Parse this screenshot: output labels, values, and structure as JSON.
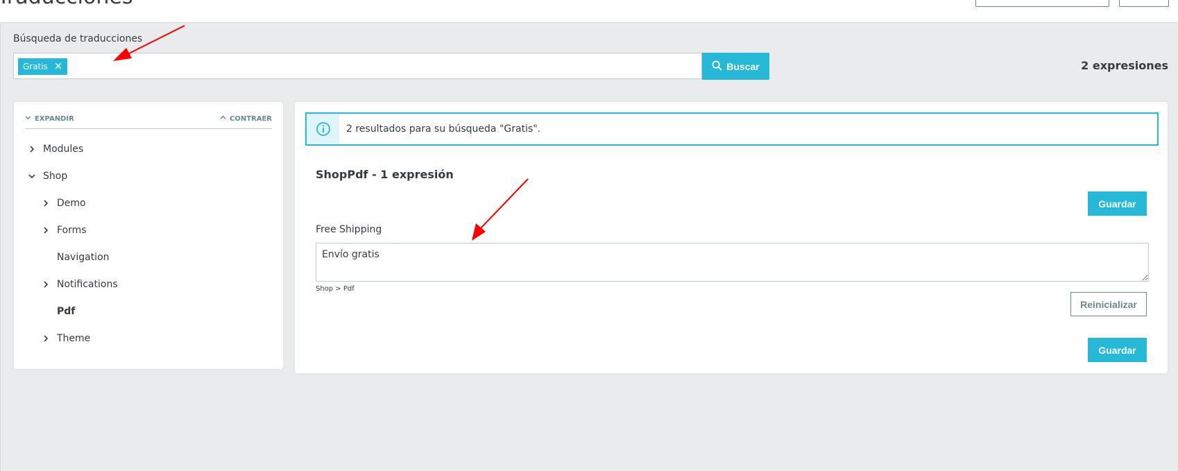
{
  "header": {
    "title": "Traducciones"
  },
  "search": {
    "label": "Búsqueda de traducciones",
    "tags": [
      {
        "label": "Gratis"
      }
    ],
    "button_label": "Buscar",
    "expressions_count": "2 expresiones"
  },
  "tree": {
    "expand_label": "EXPANDIR",
    "collapse_label": "CONTRAER",
    "items": [
      {
        "label": "Modules",
        "level": 0,
        "chevron": "right"
      },
      {
        "label": "Shop",
        "level": 0,
        "chevron": "down"
      },
      {
        "label": "Demo",
        "level": 1,
        "chevron": "right"
      },
      {
        "label": "Forms",
        "level": 1,
        "chevron": "right"
      },
      {
        "label": "Navigation",
        "level": 1,
        "chevron": "none"
      },
      {
        "label": "Notifications",
        "level": 1,
        "chevron": "right"
      },
      {
        "label": "Pdf",
        "level": 1,
        "chevron": "none",
        "active": true
      },
      {
        "label": "Theme",
        "level": 1,
        "chevron": "right"
      }
    ]
  },
  "content": {
    "alert_text": "2 resultados para su búsqueda \"Gratis\".",
    "section_title": "ShopPdf - 1 expresión",
    "save_label": "Guardar",
    "field": {
      "label": "Free Shipping",
      "value": "Envío gratis",
      "path": "Shop > Pdf"
    },
    "reset_label": "Reinicializar"
  },
  "colors": {
    "primary": "#25b9d7",
    "annotation": "#ff0000",
    "background": "#eaebec"
  }
}
